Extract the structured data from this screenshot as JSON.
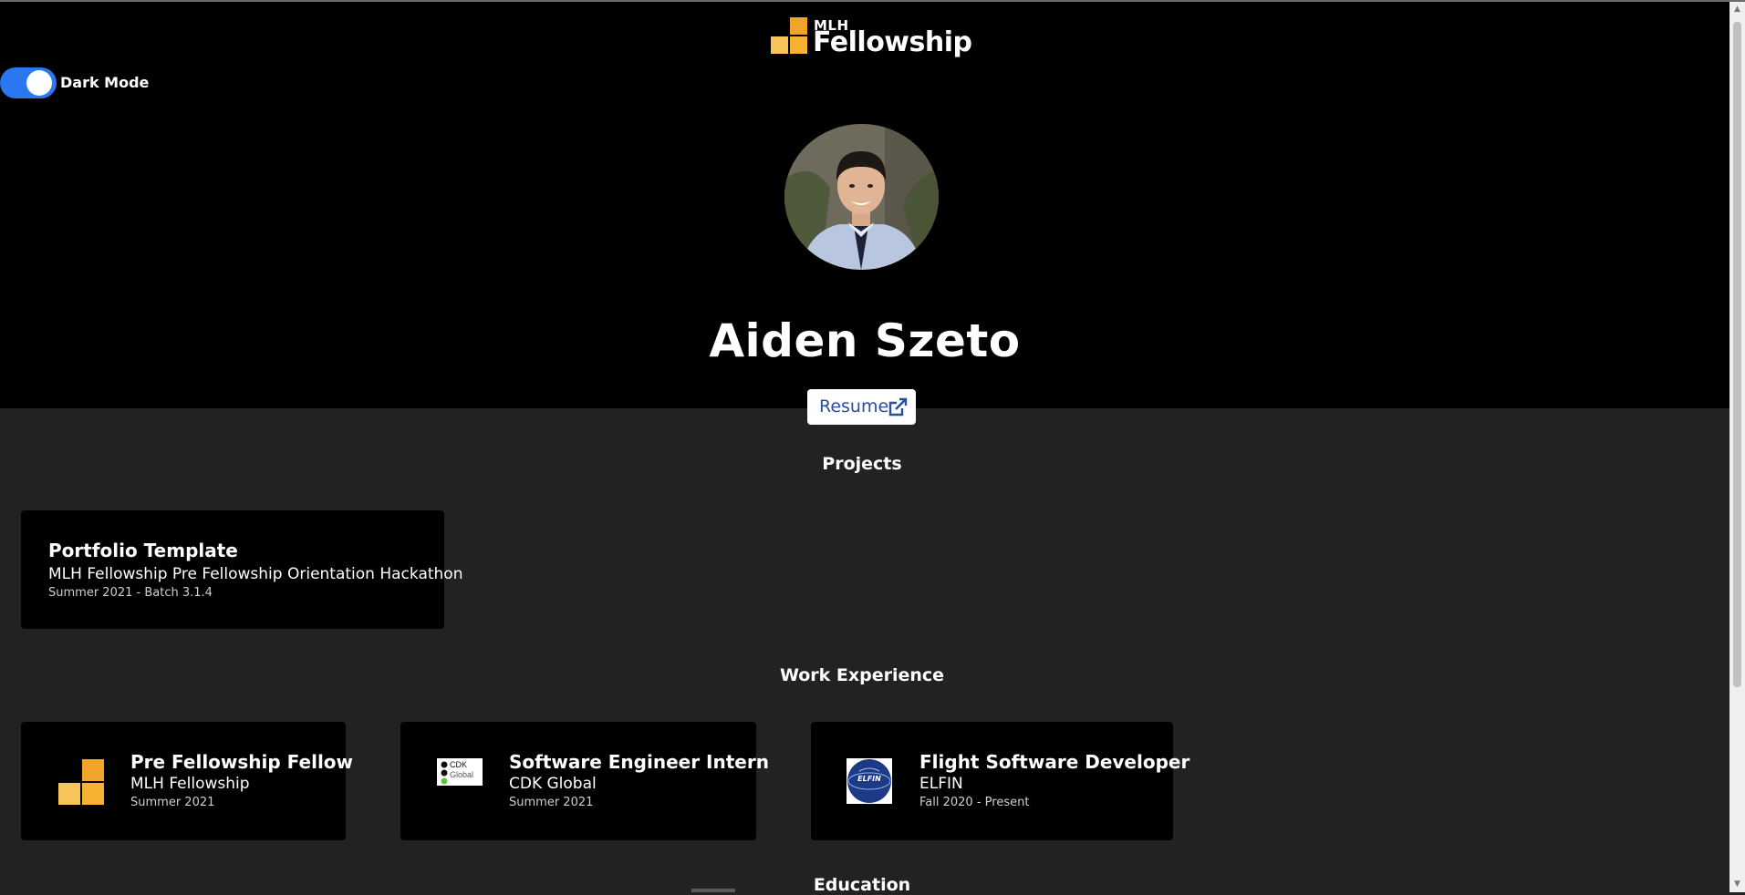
{
  "logo": {
    "small": "MLH",
    "big": "Fellowship"
  },
  "toggle": {
    "label": "Dark Mode",
    "state": "on"
  },
  "profile": {
    "name": "Aiden Szeto",
    "resume_label": "Resume"
  },
  "projects": {
    "title": "Projects",
    "items": [
      {
        "title": "Portfolio Template",
        "subtitle": "MLH Fellowship Pre Fellowship Orientation Hackathon",
        "date": "Summer 2021 - Batch 3.1.4"
      }
    ]
  },
  "work": {
    "title": "Work Experience",
    "items": [
      {
        "title": "Pre Fellowship Fellow",
        "company": "MLH Fellowship",
        "date": "Summer 2021",
        "icon": "mlh-logo-icon"
      },
      {
        "title": "Software Engineer Intern",
        "company": "CDK Global",
        "date": "Summer 2021",
        "icon": "cdk-global-logo-icon",
        "logo_text": [
          "CDK",
          "Global"
        ]
      },
      {
        "title": "Flight Software Developer",
        "company": "ELFIN",
        "date": "Fall 2020 - Present",
        "icon": "elfin-logo-icon",
        "logo_text": "ELFIN"
      }
    ]
  },
  "education": {
    "title": "Education"
  },
  "colors": {
    "page_bg": "#222222",
    "hero_bg": "#000000",
    "toggle": "#2a77f0",
    "logo_yellow": "#f5b331",
    "link": "#2a4d9c"
  }
}
